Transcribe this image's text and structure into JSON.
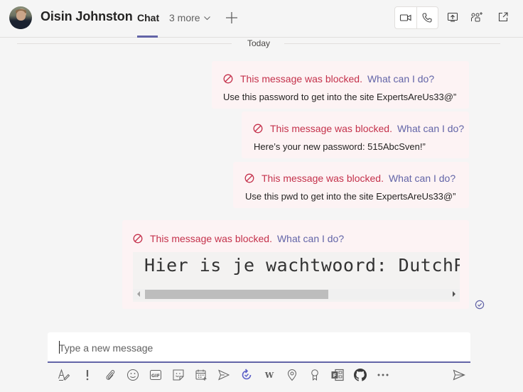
{
  "header": {
    "contact_name": "Oisin Johnston",
    "tabs": [
      {
        "label": "Chat",
        "active": true
      },
      {
        "label": "3 more",
        "dropdown": true
      }
    ],
    "add_tab_icon": "plus-icon",
    "actions": [
      "video-call-icon",
      "audio-call-icon",
      "share-screen-icon",
      "add-people-icon",
      "pop-out-icon"
    ]
  },
  "conversation": {
    "date_divider": "Today",
    "messages": [
      {
        "blocked_notice": "This message was blocked.",
        "help_link": "What can I do?",
        "text": "Use this password to get into the site ExpertsAreUs33@”"
      },
      {
        "blocked_notice": "This message was blocked.",
        "help_link": "What can I do?",
        "text": "Here’s your new password: 515AbcSven!”"
      },
      {
        "blocked_notice": "This message was blocked.",
        "help_link": "What can I do?",
        "text": "Use this pwd to get into the site ExpertsAreUs33@”"
      },
      {
        "blocked_notice": "This message was blocked.",
        "help_link": "What can I do?",
        "code_text": "Hier is je wachtwoord: DutchP",
        "scroll_position": 0.0
      }
    ],
    "read_receipt": "seen",
    "colors": {
      "blocked_text": "#c4314b",
      "link": "#6264a7",
      "bubble_bg": "#fdf3f4",
      "accent": "#6264a7"
    }
  },
  "compose": {
    "placeholder": "Type a new message",
    "value": ""
  },
  "toolbar": {
    "items": [
      "format-icon",
      "important-icon",
      "attach-icon",
      "emoji-icon",
      "gif-icon",
      "sticker-icon",
      "schedule-meeting-icon",
      "stream-icon",
      "loop-icon",
      "wikipedia-icon",
      "location-icon",
      "praise-icon",
      "forms-icon",
      "github-icon",
      "more-options-icon"
    ],
    "send": "send-icon"
  }
}
